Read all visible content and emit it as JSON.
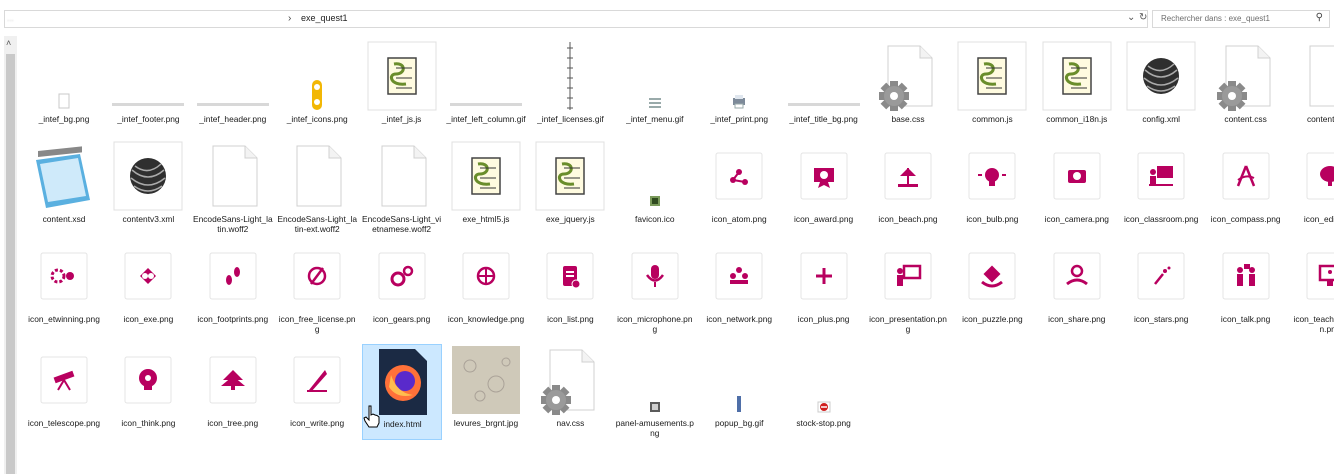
{
  "address": {
    "path_blurred": "...",
    "current_folder": "exe_quest1",
    "separator": "›",
    "dropdown_icon": "chevron-down-icon",
    "refresh_icon": "refresh-icon"
  },
  "search": {
    "placeholder": "Rechercher dans : exe_quest1",
    "icon": "search-icon"
  },
  "files": [
    {
      "name": "_intef_bg.png",
      "icon": "tiny-image"
    },
    {
      "name": "_intef_footer.png",
      "icon": "thin-strip"
    },
    {
      "name": "_intef_header.png",
      "icon": "thin-strip"
    },
    {
      "name": "_intef_icons.png",
      "icon": "sprite-yellow"
    },
    {
      "name": "_intef_js.js",
      "icon": "js-script"
    },
    {
      "name": "_intef_left_column.gif",
      "icon": "thin-strip"
    },
    {
      "name": "_intef_licenses.gif",
      "icon": "vertical-strip"
    },
    {
      "name": "_intef_menu.gif",
      "icon": "menu-lines"
    },
    {
      "name": "_intef_print.png",
      "icon": "printer"
    },
    {
      "name": "_intef_title_bg.png",
      "icon": "thin-strip"
    },
    {
      "name": "base.css",
      "icon": "gear-doc"
    },
    {
      "name": "common.js",
      "icon": "js-script"
    },
    {
      "name": "common_i18n.js",
      "icon": "js-script"
    },
    {
      "name": "config.xml",
      "icon": "sphere"
    },
    {
      "name": "content.css",
      "icon": "gear-doc"
    },
    {
      "name": "content.data",
      "icon": "blank-doc"
    },
    {
      "name": "content.xsd",
      "icon": "notepad"
    },
    {
      "name": "contentv3.xml",
      "icon": "sphere"
    },
    {
      "name": "EncodeSans-Light_latin.woff2",
      "icon": "blank-doc"
    },
    {
      "name": "EncodeSans-Light_latin-ext.woff2",
      "icon": "blank-doc"
    },
    {
      "name": "EncodeSans-Light_vietnamese.woff2",
      "icon": "blank-doc"
    },
    {
      "name": "exe_html5.js",
      "icon": "js-script"
    },
    {
      "name": "exe_jquery.js",
      "icon": "js-script"
    },
    {
      "name": "favicon.ico",
      "icon": "favicon"
    },
    {
      "name": "icon_atom.png",
      "icon": "magenta-atom"
    },
    {
      "name": "icon_award.png",
      "icon": "magenta-award"
    },
    {
      "name": "icon_beach.png",
      "icon": "magenta-beach"
    },
    {
      "name": "icon_bulb.png",
      "icon": "magenta-bulb"
    },
    {
      "name": "icon_camera.png",
      "icon": "magenta-camera"
    },
    {
      "name": "icon_classroom.png",
      "icon": "magenta-classroom"
    },
    {
      "name": "icon_compass.png",
      "icon": "magenta-compass"
    },
    {
      "name": "icon_edia.png",
      "icon": "magenta-brain"
    },
    {
      "name": "icon_etwinning.png",
      "icon": "magenta-etwinning"
    },
    {
      "name": "icon_exe.png",
      "icon": "magenta-exe"
    },
    {
      "name": "icon_footprints.png",
      "icon": "magenta-footprints"
    },
    {
      "name": "icon_free_license.png",
      "icon": "magenta-nolicense"
    },
    {
      "name": "icon_gears.png",
      "icon": "magenta-gears"
    },
    {
      "name": "icon_knowledge.png",
      "icon": "magenta-knowledge"
    },
    {
      "name": "icon_list.png",
      "icon": "magenta-list"
    },
    {
      "name": "icon_microphone.png",
      "icon": "magenta-microphone"
    },
    {
      "name": "icon_network.png",
      "icon": "magenta-network"
    },
    {
      "name": "icon_plus.png",
      "icon": "magenta-plus"
    },
    {
      "name": "icon_presentation.png",
      "icon": "magenta-presentation"
    },
    {
      "name": "icon_puzzle.png",
      "icon": "magenta-puzzle"
    },
    {
      "name": "icon_share.png",
      "icon": "magenta-share"
    },
    {
      "name": "icon_stars.png",
      "icon": "magenta-stars"
    },
    {
      "name": "icon_talk.png",
      "icon": "magenta-talk"
    },
    {
      "name": "icon_teacher_screen.png",
      "icon": "magenta-teacher-screen"
    },
    {
      "name": "icon_telescope.png",
      "icon": "magenta-telescope"
    },
    {
      "name": "icon_think.png",
      "icon": "magenta-think"
    },
    {
      "name": "icon_tree.png",
      "icon": "magenta-tree"
    },
    {
      "name": "icon_write.png",
      "icon": "magenta-write"
    },
    {
      "name": "index.html",
      "icon": "firefox-doc",
      "selected": true
    },
    {
      "name": "levures_brgnt.jpg",
      "icon": "photo"
    },
    {
      "name": "nav.css",
      "icon": "gear-doc"
    },
    {
      "name": "panel-amusements.png",
      "icon": "panel-small"
    },
    {
      "name": "popup_bg.gif",
      "icon": "popup-strip"
    },
    {
      "name": "stock-stop.png",
      "icon": "stop-sign"
    }
  ],
  "colors": {
    "accent": "#b8005f",
    "selection": "#cce8ff",
    "selection_border": "#99d1ff"
  }
}
